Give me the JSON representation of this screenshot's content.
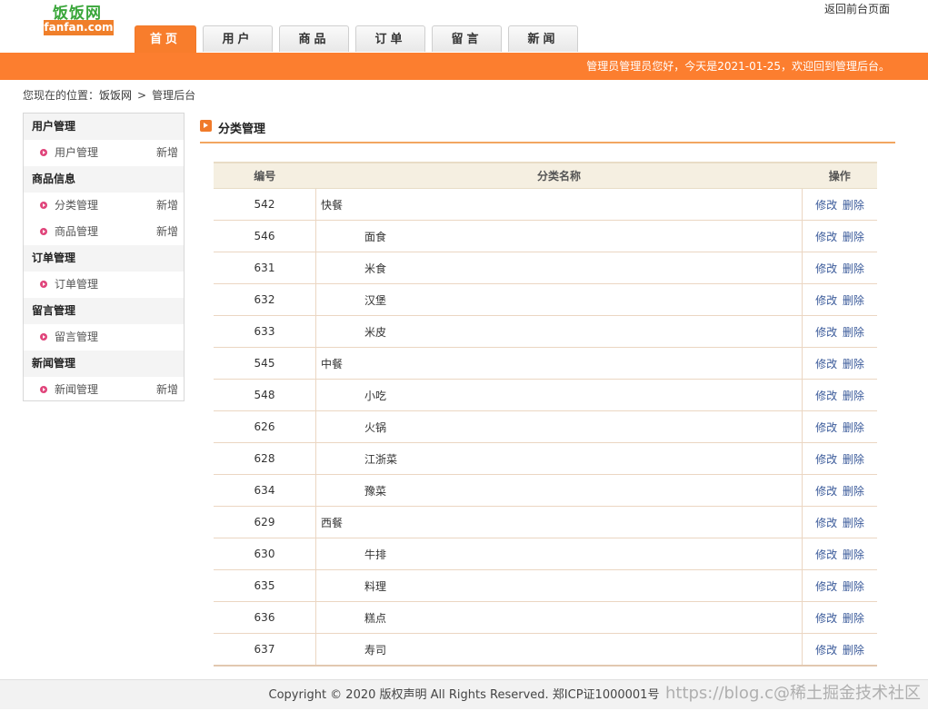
{
  "header": {
    "logo_cn": "饭饭网",
    "logo_en": "fanfan.com",
    "top_link": "返回前台页面",
    "nav": [
      "首页",
      "用户",
      "商品",
      "订单",
      "留言",
      "新闻"
    ],
    "greeting": "管理员管理员您好，今天是2021-01-25，欢迎回到管理后台。"
  },
  "breadcrumb": {
    "prefix": "您现在的位置：",
    "home": "饭饭网",
    "sep": ">",
    "current": "管理后台"
  },
  "sidebar": [
    {
      "title": "用户管理",
      "items": [
        {
          "label": "用户管理",
          "add": "新增"
        }
      ]
    },
    {
      "title": "商品信息",
      "items": [
        {
          "label": "分类管理",
          "add": "新增"
        },
        {
          "label": "商品管理",
          "add": "新增"
        }
      ]
    },
    {
      "title": "订单管理",
      "items": [
        {
          "label": "订单管理",
          "add": ""
        }
      ]
    },
    {
      "title": "留言管理",
      "items": [
        {
          "label": "留言管理",
          "add": ""
        }
      ]
    },
    {
      "title": "新闻管理",
      "items": [
        {
          "label": "新闻管理",
          "add": "新增"
        }
      ]
    }
  ],
  "panel": {
    "title": "分类管理",
    "columns": {
      "id": "编号",
      "name": "分类名称",
      "ops": "操作"
    },
    "edit_label": "修改",
    "delete_label": "删除",
    "rows": [
      {
        "id": "542",
        "name": "快餐",
        "child": false
      },
      {
        "id": "546",
        "name": "面食",
        "child": true
      },
      {
        "id": "631",
        "name": "米食",
        "child": true
      },
      {
        "id": "632",
        "name": "汉堡",
        "child": true
      },
      {
        "id": "633",
        "name": "米皮",
        "child": true
      },
      {
        "id": "545",
        "name": "中餐",
        "child": false
      },
      {
        "id": "548",
        "name": "小吃",
        "child": true
      },
      {
        "id": "626",
        "name": "火锅",
        "child": true
      },
      {
        "id": "628",
        "name": "江浙菜",
        "child": true
      },
      {
        "id": "634",
        "name": "豫菜",
        "child": true
      },
      {
        "id": "629",
        "name": "西餐",
        "child": false
      },
      {
        "id": "630",
        "name": "牛排",
        "child": true
      },
      {
        "id": "635",
        "name": "料理",
        "child": true
      },
      {
        "id": "636",
        "name": "糕点",
        "child": true
      },
      {
        "id": "637",
        "name": "寿司",
        "child": true
      }
    ]
  },
  "footer": {
    "copyright": "Copyright © 2020 版权声明 All Rights Reserved. 郑ICP证1000001号",
    "watermark": "https://blog.c@稀土掘金技术社区"
  },
  "colors": {
    "accent": "#fc7e2f",
    "logo_green": "#3aa63a",
    "bullet": "#e0457b",
    "link": "#3a5a9a"
  }
}
